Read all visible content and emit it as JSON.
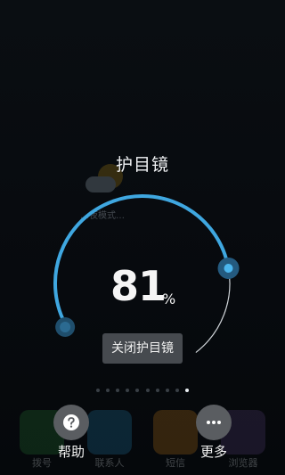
{
  "overlay": {
    "title": "护目镜",
    "brightness_percent": 81,
    "brightness_value_text": "81",
    "unit": "%",
    "close_button_label": "关闭护目镜",
    "arc_color": "#3fa7e0"
  },
  "background": {
    "weather_text": "…夜模式…",
    "dock": [
      "拨号",
      "联系人",
      "短信",
      "浏览器"
    ]
  },
  "pager": {
    "count": 10,
    "active_index": 9
  },
  "actions": {
    "help_label": "帮助",
    "more_label": "更多",
    "help_icon": "question-icon",
    "more_icon": "ellipsis-icon"
  }
}
